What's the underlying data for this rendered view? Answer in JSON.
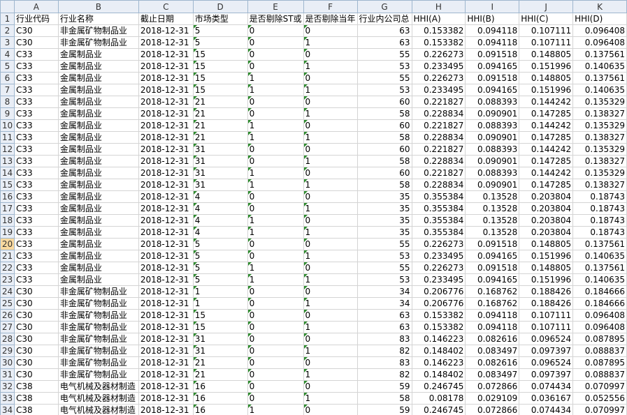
{
  "columns": [
    "A",
    "B",
    "C",
    "D",
    "E",
    "F",
    "G",
    "H",
    "I",
    "J",
    "K"
  ],
  "header_row": [
    "行业代码",
    "行业名称",
    "截止日期",
    "市场类型",
    "是否剔除ST或",
    "是否剔除当年",
    "行业内公司总",
    "HHI(A)",
    "HHI(B)",
    "HHI(C)",
    "HHI(D)"
  ],
  "rows": [
    [
      "C30",
      "非金属矿物制品业",
      "2018-12-31",
      "5",
      "0",
      "0",
      "63",
      "0.153382",
      "0.094118",
      "0.107111",
      "0.096408"
    ],
    [
      "C30",
      "非金属矿物制品业",
      "2018-12-31",
      "5",
      "0",
      "1",
      "63",
      "0.153382",
      "0.094118",
      "0.107111",
      "0.096408"
    ],
    [
      "C33",
      "金属制品业",
      "2018-12-31",
      "15",
      "0",
      "0",
      "55",
      "0.226273",
      "0.091518",
      "0.148805",
      "0.137561"
    ],
    [
      "C33",
      "金属制品业",
      "2018-12-31",
      "15",
      "0",
      "1",
      "53",
      "0.233495",
      "0.094165",
      "0.151996",
      "0.140635"
    ],
    [
      "C33",
      "金属制品业",
      "2018-12-31",
      "15",
      "1",
      "0",
      "55",
      "0.226273",
      "0.091518",
      "0.148805",
      "0.137561"
    ],
    [
      "C33",
      "金属制品业",
      "2018-12-31",
      "15",
      "1",
      "1",
      "53",
      "0.233495",
      "0.094165",
      "0.151996",
      "0.140635"
    ],
    [
      "C33",
      "金属制品业",
      "2018-12-31",
      "21",
      "0",
      "0",
      "60",
      "0.221827",
      "0.088393",
      "0.144242",
      "0.135329"
    ],
    [
      "C33",
      "金属制品业",
      "2018-12-31",
      "21",
      "0",
      "1",
      "58",
      "0.228834",
      "0.090901",
      "0.147285",
      "0.138327"
    ],
    [
      "C33",
      "金属制品业",
      "2018-12-31",
      "21",
      "1",
      "0",
      "60",
      "0.221827",
      "0.088393",
      "0.144242",
      "0.135329"
    ],
    [
      "C33",
      "金属制品业",
      "2018-12-31",
      "21",
      "1",
      "1",
      "58",
      "0.228834",
      "0.090901",
      "0.147285",
      "0.138327"
    ],
    [
      "C33",
      "金属制品业",
      "2018-12-31",
      "31",
      "0",
      "0",
      "60",
      "0.221827",
      "0.088393",
      "0.144242",
      "0.135329"
    ],
    [
      "C33",
      "金属制品业",
      "2018-12-31",
      "31",
      "0",
      "1",
      "58",
      "0.228834",
      "0.090901",
      "0.147285",
      "0.138327"
    ],
    [
      "C33",
      "金属制品业",
      "2018-12-31",
      "31",
      "1",
      "0",
      "60",
      "0.221827",
      "0.088393",
      "0.144242",
      "0.135329"
    ],
    [
      "C33",
      "金属制品业",
      "2018-12-31",
      "31",
      "1",
      "1",
      "58",
      "0.228834",
      "0.090901",
      "0.147285",
      "0.138327"
    ],
    [
      "C33",
      "金属制品业",
      "2018-12-31",
      "4",
      "0",
      "0",
      "35",
      "0.355384",
      "0.13528",
      "0.203804",
      "0.18743"
    ],
    [
      "C33",
      "金属制品业",
      "2018-12-31",
      "4",
      "0",
      "1",
      "35",
      "0.355384",
      "0.13528",
      "0.203804",
      "0.18743"
    ],
    [
      "C33",
      "金属制品业",
      "2018-12-31",
      "4",
      "1",
      "0",
      "35",
      "0.355384",
      "0.13528",
      "0.203804",
      "0.18743"
    ],
    [
      "C33",
      "金属制品业",
      "2018-12-31",
      "4",
      "1",
      "1",
      "35",
      "0.355384",
      "0.13528",
      "0.203804",
      "0.18743"
    ],
    [
      "C33",
      "金属制品业",
      "2018-12-31",
      "5",
      "0",
      "0",
      "55",
      "0.226273",
      "0.091518",
      "0.148805",
      "0.137561"
    ],
    [
      "C33",
      "金属制品业",
      "2018-12-31",
      "5",
      "0",
      "1",
      "53",
      "0.233495",
      "0.094165",
      "0.151996",
      "0.140635"
    ],
    [
      "C33",
      "金属制品业",
      "2018-12-31",
      "5",
      "1",
      "0",
      "55",
      "0.226273",
      "0.091518",
      "0.148805",
      "0.137561"
    ],
    [
      "C33",
      "金属制品业",
      "2018-12-31",
      "5",
      "1",
      "1",
      "53",
      "0.233495",
      "0.094165",
      "0.151996",
      "0.140635"
    ],
    [
      "C30",
      "非金属矿物制品业",
      "2018-12-31",
      "1",
      "0",
      "0",
      "34",
      "0.206776",
      "0.168762",
      "0.188426",
      "0.184666"
    ],
    [
      "C30",
      "非金属矿物制品业",
      "2018-12-31",
      "1",
      "0",
      "1",
      "34",
      "0.206776",
      "0.168762",
      "0.188426",
      "0.184666"
    ],
    [
      "C30",
      "非金属矿物制品业",
      "2018-12-31",
      "15",
      "0",
      "0",
      "63",
      "0.153382",
      "0.094118",
      "0.107111",
      "0.096408"
    ],
    [
      "C30",
      "非金属矿物制品业",
      "2018-12-31",
      "15",
      "0",
      "1",
      "63",
      "0.153382",
      "0.094118",
      "0.107111",
      "0.096408"
    ],
    [
      "C30",
      "非金属矿物制品业",
      "2018-12-31",
      "31",
      "0",
      "0",
      "83",
      "0.146223",
      "0.082616",
      "0.096524",
      "0.087895"
    ],
    [
      "C30",
      "非金属矿物制品业",
      "2018-12-31",
      "31",
      "0",
      "1",
      "82",
      "0.148402",
      "0.083497",
      "0.097397",
      "0.088837"
    ],
    [
      "C30",
      "非金属矿物制品业",
      "2018-12-31",
      "21",
      "0",
      "0",
      "83",
      "0.146223",
      "0.082616",
      "0.096524",
      "0.087895"
    ],
    [
      "C30",
      "非金属矿物制品业",
      "2018-12-31",
      "21",
      "0",
      "1",
      "82",
      "0.148402",
      "0.083497",
      "0.097397",
      "0.088837"
    ],
    [
      "C38",
      "电气机械及器材制造",
      "2018-12-31",
      "16",
      "0",
      "0",
      "59",
      "0.246745",
      "0.072866",
      "0.074434",
      "0.070997"
    ],
    [
      "C38",
      "电气机械及器材制造",
      "2018-12-31",
      "16",
      "0",
      "1",
      "58",
      "0.08178",
      "0.029109",
      "0.036167",
      "0.052556"
    ],
    [
      "C38",
      "电气机械及器材制造",
      "2018-12-31",
      "16",
      "1",
      "0",
      "59",
      "0.246745",
      "0.072866",
      "0.074434",
      "0.070997"
    ]
  ],
  "selected_row": "20",
  "row_numbers": [
    "1",
    "2",
    "3",
    "4",
    "5",
    "6",
    "7",
    "8",
    "9",
    "10",
    "11",
    "12",
    "13",
    "14",
    "15",
    "16",
    "17",
    "18",
    "19",
    "20",
    "21",
    "22",
    "23",
    "24",
    "25",
    "26",
    "27",
    "28",
    "29",
    "30",
    "31",
    "32",
    "33",
    "34"
  ]
}
